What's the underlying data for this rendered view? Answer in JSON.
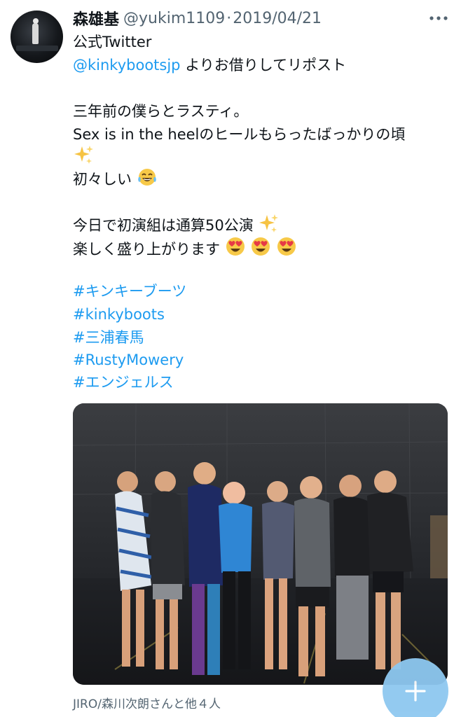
{
  "tweet": {
    "author_name": "森雄基",
    "handle": "@yukim1109",
    "separator": "·",
    "date": "2019/04/21",
    "lines": {
      "l1": "公式Twitter",
      "l2_mention": "@kinkybootsjp",
      "l2_rest": " よりお借りしてリポスト",
      "l3": "三年前の僕らとラスティ。",
      "l4": "Sex is in the heelのヒールもらったばっかりの頃",
      "l6": "初々しい",
      "l7": "今日で初演組は通算50公演",
      "l8": "楽しく盛り上がります"
    },
    "hashtags": [
      "#キンキーブーツ",
      "#kinkyboots",
      "#三浦春馬",
      "#RustyMowery",
      "#エンジェルス"
    ],
    "tagged_people": "JIRO/森川次朗さんと他４人",
    "link_color": "#1d9bf0",
    "muted_color": "#536471"
  },
  "icons": {
    "more": "more-horizontal-icon",
    "sparkles": "sparkles-icon",
    "laugh": "tears-of-joy-emoji",
    "heart_eyes": "heart-eyes-emoji",
    "compose": "plus-icon"
  }
}
